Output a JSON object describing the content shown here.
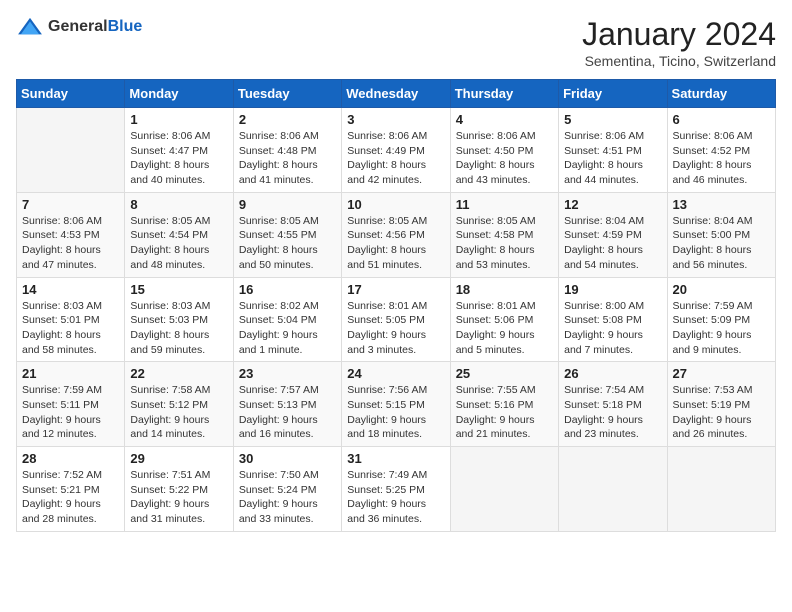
{
  "logo": {
    "general": "General",
    "blue": "Blue"
  },
  "title": "January 2024",
  "location": "Sementina, Ticino, Switzerland",
  "headers": [
    "Sunday",
    "Monday",
    "Tuesday",
    "Wednesday",
    "Thursday",
    "Friday",
    "Saturday"
  ],
  "weeks": [
    [
      {
        "day": "",
        "info": ""
      },
      {
        "day": "1",
        "info": "Sunrise: 8:06 AM\nSunset: 4:47 PM\nDaylight: 8 hours\nand 40 minutes."
      },
      {
        "day": "2",
        "info": "Sunrise: 8:06 AM\nSunset: 4:48 PM\nDaylight: 8 hours\nand 41 minutes."
      },
      {
        "day": "3",
        "info": "Sunrise: 8:06 AM\nSunset: 4:49 PM\nDaylight: 8 hours\nand 42 minutes."
      },
      {
        "day": "4",
        "info": "Sunrise: 8:06 AM\nSunset: 4:50 PM\nDaylight: 8 hours\nand 43 minutes."
      },
      {
        "day": "5",
        "info": "Sunrise: 8:06 AM\nSunset: 4:51 PM\nDaylight: 8 hours\nand 44 minutes."
      },
      {
        "day": "6",
        "info": "Sunrise: 8:06 AM\nSunset: 4:52 PM\nDaylight: 8 hours\nand 46 minutes."
      }
    ],
    [
      {
        "day": "7",
        "info": "Sunrise: 8:06 AM\nSunset: 4:53 PM\nDaylight: 8 hours\nand 47 minutes."
      },
      {
        "day": "8",
        "info": "Sunrise: 8:05 AM\nSunset: 4:54 PM\nDaylight: 8 hours\nand 48 minutes."
      },
      {
        "day": "9",
        "info": "Sunrise: 8:05 AM\nSunset: 4:55 PM\nDaylight: 8 hours\nand 50 minutes."
      },
      {
        "day": "10",
        "info": "Sunrise: 8:05 AM\nSunset: 4:56 PM\nDaylight: 8 hours\nand 51 minutes."
      },
      {
        "day": "11",
        "info": "Sunrise: 8:05 AM\nSunset: 4:58 PM\nDaylight: 8 hours\nand 53 minutes."
      },
      {
        "day": "12",
        "info": "Sunrise: 8:04 AM\nSunset: 4:59 PM\nDaylight: 8 hours\nand 54 minutes."
      },
      {
        "day": "13",
        "info": "Sunrise: 8:04 AM\nSunset: 5:00 PM\nDaylight: 8 hours\nand 56 minutes."
      }
    ],
    [
      {
        "day": "14",
        "info": "Sunrise: 8:03 AM\nSunset: 5:01 PM\nDaylight: 8 hours\nand 58 minutes."
      },
      {
        "day": "15",
        "info": "Sunrise: 8:03 AM\nSunset: 5:03 PM\nDaylight: 8 hours\nand 59 minutes."
      },
      {
        "day": "16",
        "info": "Sunrise: 8:02 AM\nSunset: 5:04 PM\nDaylight: 9 hours\nand 1 minute."
      },
      {
        "day": "17",
        "info": "Sunrise: 8:01 AM\nSunset: 5:05 PM\nDaylight: 9 hours\nand 3 minutes."
      },
      {
        "day": "18",
        "info": "Sunrise: 8:01 AM\nSunset: 5:06 PM\nDaylight: 9 hours\nand 5 minutes."
      },
      {
        "day": "19",
        "info": "Sunrise: 8:00 AM\nSunset: 5:08 PM\nDaylight: 9 hours\nand 7 minutes."
      },
      {
        "day": "20",
        "info": "Sunrise: 7:59 AM\nSunset: 5:09 PM\nDaylight: 9 hours\nand 9 minutes."
      }
    ],
    [
      {
        "day": "21",
        "info": "Sunrise: 7:59 AM\nSunset: 5:11 PM\nDaylight: 9 hours\nand 12 minutes."
      },
      {
        "day": "22",
        "info": "Sunrise: 7:58 AM\nSunset: 5:12 PM\nDaylight: 9 hours\nand 14 minutes."
      },
      {
        "day": "23",
        "info": "Sunrise: 7:57 AM\nSunset: 5:13 PM\nDaylight: 9 hours\nand 16 minutes."
      },
      {
        "day": "24",
        "info": "Sunrise: 7:56 AM\nSunset: 5:15 PM\nDaylight: 9 hours\nand 18 minutes."
      },
      {
        "day": "25",
        "info": "Sunrise: 7:55 AM\nSunset: 5:16 PM\nDaylight: 9 hours\nand 21 minutes."
      },
      {
        "day": "26",
        "info": "Sunrise: 7:54 AM\nSunset: 5:18 PM\nDaylight: 9 hours\nand 23 minutes."
      },
      {
        "day": "27",
        "info": "Sunrise: 7:53 AM\nSunset: 5:19 PM\nDaylight: 9 hours\nand 26 minutes."
      }
    ],
    [
      {
        "day": "28",
        "info": "Sunrise: 7:52 AM\nSunset: 5:21 PM\nDaylight: 9 hours\nand 28 minutes."
      },
      {
        "day": "29",
        "info": "Sunrise: 7:51 AM\nSunset: 5:22 PM\nDaylight: 9 hours\nand 31 minutes."
      },
      {
        "day": "30",
        "info": "Sunrise: 7:50 AM\nSunset: 5:24 PM\nDaylight: 9 hours\nand 33 minutes."
      },
      {
        "day": "31",
        "info": "Sunrise: 7:49 AM\nSunset: 5:25 PM\nDaylight: 9 hours\nand 36 minutes."
      },
      {
        "day": "",
        "info": ""
      },
      {
        "day": "",
        "info": ""
      },
      {
        "day": "",
        "info": ""
      }
    ]
  ]
}
